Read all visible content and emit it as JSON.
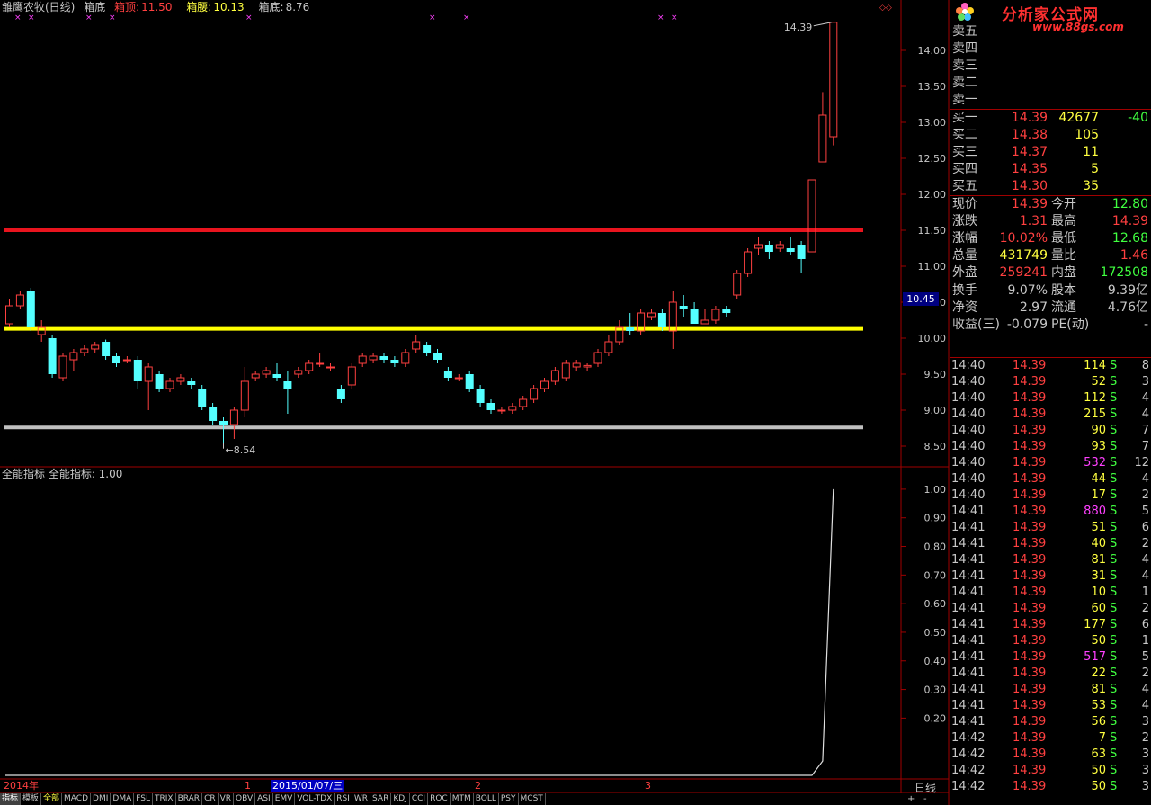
{
  "header": {
    "stock_name": "雏鹰农牧(日线)",
    "box_label": "箱底",
    "top_label": "箱顶:",
    "top_value": "11.50",
    "mid_label": "箱腰:",
    "mid_value": "10.13",
    "bot_label": "箱底:",
    "bot_value": "8.76"
  },
  "colors": {
    "up": "#ff4040",
    "down": "#54ffff",
    "box_top": "#e8141e",
    "box_mid": "#ffff00",
    "box_bot": "#c0c0c0",
    "marker": "#ff40ff",
    "grid": "#a00000"
  },
  "chart_data": [
    {
      "type": "candlestick",
      "ylim": [
        8.3,
        14.5
      ],
      "yticks": [
        "14.00",
        "13.50",
        "13.00",
        "12.50",
        "12.00",
        "11.50",
        "11.00",
        "10.50",
        "10.00",
        "9.50",
        "9.00",
        "8.50"
      ],
      "current_price": "10.45",
      "box_lines": {
        "top": 11.5,
        "mid": 10.13,
        "bot": 8.76
      },
      "high_annotation": "14.39",
      "low_annotation": "8.54",
      "candles": [
        [
          10.2,
          10.45,
          10.55,
          10.15
        ],
        [
          10.45,
          10.6,
          10.65,
          10.4
        ],
        [
          10.65,
          10.15,
          10.7,
          10.1
        ],
        [
          10.05,
          10.15,
          10.25,
          9.95
        ],
        [
          10.0,
          9.5,
          10.05,
          9.45
        ],
        [
          9.45,
          9.75,
          9.8,
          9.4
        ],
        [
          9.7,
          9.8,
          9.85,
          9.55
        ],
        [
          9.8,
          9.85,
          9.9,
          9.75
        ],
        [
          9.85,
          9.9,
          9.95,
          9.8
        ],
        [
          9.95,
          9.75,
          9.98,
          9.7
        ],
        [
          9.75,
          9.65,
          9.8,
          9.6
        ],
        [
          9.7,
          9.7,
          9.75,
          9.65
        ],
        [
          9.7,
          9.4,
          9.75,
          9.3
        ],
        [
          9.4,
          9.6,
          9.65,
          9.0
        ],
        [
          9.5,
          9.3,
          9.55,
          9.25
        ],
        [
          9.3,
          9.4,
          9.45,
          9.25
        ],
        [
          9.4,
          9.45,
          9.5,
          9.35
        ],
        [
          9.4,
          9.35,
          9.45,
          9.3
        ],
        [
          9.3,
          9.05,
          9.35,
          9.0
        ],
        [
          9.05,
          8.85,
          9.1,
          8.8
        ],
        [
          8.85,
          8.8,
          8.9,
          8.54
        ],
        [
          8.8,
          9.0,
          9.05,
          8.6
        ],
        [
          9.0,
          9.4,
          9.6,
          8.9
        ],
        [
          9.45,
          9.5,
          9.55,
          9.4
        ],
        [
          9.5,
          9.55,
          9.6,
          9.45
        ],
        [
          9.5,
          9.45,
          9.65,
          9.4
        ],
        [
          9.4,
          9.3,
          9.55,
          8.95
        ],
        [
          9.5,
          9.55,
          9.6,
          9.45
        ],
        [
          9.55,
          9.65,
          9.7,
          9.5
        ],
        [
          9.65,
          9.65,
          9.8,
          9.6
        ],
        [
          9.6,
          9.6,
          9.65,
          9.55
        ],
        [
          9.3,
          9.15,
          9.35,
          9.1
        ],
        [
          9.35,
          9.6,
          9.65,
          9.3
        ],
        [
          9.65,
          9.75,
          9.8,
          9.6
        ],
        [
          9.7,
          9.75,
          9.8,
          9.65
        ],
        [
          9.75,
          9.7,
          9.8,
          9.65
        ],
        [
          9.7,
          9.65,
          9.75,
          9.6
        ],
        [
          9.65,
          9.8,
          9.85,
          9.6
        ],
        [
          9.85,
          9.95,
          10.05,
          9.8
        ],
        [
          9.9,
          9.8,
          9.95,
          9.75
        ],
        [
          9.8,
          9.7,
          9.85,
          9.65
        ],
        [
          9.55,
          9.45,
          9.6,
          9.4
        ],
        [
          9.45,
          9.45,
          9.5,
          9.4
        ],
        [
          9.5,
          9.3,
          9.55,
          9.25
        ],
        [
          9.3,
          9.1,
          9.35,
          9.05
        ],
        [
          9.1,
          9.0,
          9.15,
          8.95
        ],
        [
          9.0,
          9.0,
          9.05,
          8.95
        ],
        [
          9.0,
          9.05,
          9.1,
          8.95
        ],
        [
          9.05,
          9.15,
          9.2,
          9.0
        ],
        [
          9.15,
          9.3,
          9.35,
          9.1
        ],
        [
          9.3,
          9.4,
          9.45,
          9.25
        ],
        [
          9.4,
          9.55,
          9.6,
          9.35
        ],
        [
          9.45,
          9.65,
          9.7,
          9.4
        ],
        [
          9.6,
          9.65,
          9.7,
          9.55
        ],
        [
          9.6,
          9.62,
          9.65,
          9.55
        ],
        [
          9.65,
          9.8,
          9.85,
          9.6
        ],
        [
          9.8,
          9.95,
          10.05,
          9.75
        ],
        [
          9.95,
          10.15,
          10.25,
          9.9
        ],
        [
          10.15,
          10.1,
          10.35,
          10.05
        ],
        [
          10.1,
          10.35,
          10.4,
          10.05
        ],
        [
          10.3,
          10.35,
          10.4,
          10.25
        ],
        [
          10.35,
          10.15,
          10.4,
          10.1
        ],
        [
          10.1,
          10.5,
          10.65,
          9.85
        ],
        [
          10.45,
          10.4,
          10.6,
          10.3
        ],
        [
          10.4,
          10.2,
          10.5,
          10.2
        ],
        [
          10.2,
          10.25,
          10.4,
          10.2
        ],
        [
          10.25,
          10.4,
          10.45,
          10.2
        ],
        [
          10.4,
          10.35,
          10.45,
          10.3
        ],
        [
          10.6,
          10.9,
          10.95,
          10.55
        ],
        [
          10.9,
          11.2,
          11.25,
          10.85
        ],
        [
          11.25,
          11.3,
          11.4,
          11.15
        ],
        [
          11.3,
          11.2,
          11.35,
          11.1
        ],
        [
          11.25,
          11.3,
          11.35,
          11.2
        ],
        [
          11.25,
          11.2,
          11.4,
          11.15
        ],
        [
          11.3,
          11.1,
          11.35,
          10.9
        ],
        [
          11.2,
          12.2,
          12.2,
          11.2
        ],
        [
          12.45,
          13.1,
          13.42,
          12.45
        ],
        [
          12.8,
          14.39,
          14.39,
          12.68
        ]
      ],
      "marker_x_fractions": [
        0.016,
        0.031,
        0.095,
        0.121,
        0.273,
        0.477,
        0.515,
        0.731,
        0.746
      ]
    },
    {
      "type": "line",
      "title": "全能指标 全能指标: 1.00",
      "ylim": [
        0,
        1.05
      ],
      "yticks": [
        "1.00",
        "0.90",
        "0.80",
        "0.70",
        "0.60",
        "0.50",
        "0.40",
        "0.30",
        "0.20"
      ],
      "note": "value 0 until the last bars, rising to 1.00",
      "values_tail": [
        0,
        0,
        0,
        0.05,
        1.0
      ]
    }
  ],
  "timeline": {
    "labels": [
      "2014年",
      "1",
      "2015/01/07/三",
      "2",
      "3"
    ],
    "right_label": "日线"
  },
  "tabs": [
    "指标",
    "模板",
    "全部",
    "MACD",
    "DMI",
    "DMA",
    "FSL",
    "TRIX",
    "BRAR",
    "CR",
    "VR",
    "OBV",
    "ASI",
    "EMV",
    "VOL-TDX",
    "RSI",
    "WR",
    "SAR",
    "KDJ",
    "CCI",
    "ROC",
    "MTM",
    "BOLL",
    "PSY",
    "MCST"
  ],
  "logo": {
    "text": "分析家公式网",
    "url": "www.88gs.com"
  },
  "order_book": {
    "sell": [
      {
        "label": "卖五",
        "price": "",
        "vol": ""
      },
      {
        "label": "卖四",
        "price": "",
        "vol": ""
      },
      {
        "label": "卖三",
        "price": "",
        "vol": ""
      },
      {
        "label": "卖二",
        "price": "",
        "vol": ""
      },
      {
        "label": "卖一",
        "price": "",
        "vol": ""
      }
    ],
    "buy": [
      {
        "label": "买一",
        "price": "14.39",
        "vol": "42677",
        "chg": "-40"
      },
      {
        "label": "买二",
        "price": "14.38",
        "vol": "105",
        "chg": ""
      },
      {
        "label": "买三",
        "price": "14.37",
        "vol": "11",
        "chg": ""
      },
      {
        "label": "买四",
        "price": "14.35",
        "vol": "5",
        "chg": ""
      },
      {
        "label": "买五",
        "price": "14.30",
        "vol": "35",
        "chg": ""
      }
    ]
  },
  "quote": [
    {
      "l1": "现价",
      "v1": "14.39",
      "c1": "red",
      "l2": "今开",
      "v2": "12.80",
      "c2": "grn"
    },
    {
      "l1": "涨跌",
      "v1": "1.31",
      "c1": "red",
      "l2": "最高",
      "v2": "14.39",
      "c2": "red"
    },
    {
      "l1": "涨幅",
      "v1": "10.02%",
      "c1": "red",
      "l2": "最低",
      "v2": "12.68",
      "c2": "grn"
    },
    {
      "l1": "总量",
      "v1": "431749",
      "c1": "yel",
      "l2": "量比",
      "v2": "1.46",
      "c2": "red"
    },
    {
      "l1": "外盘",
      "v1": "259241",
      "c1": "red",
      "l2": "内盘",
      "v2": "172508",
      "c2": "grn"
    }
  ],
  "finance": [
    {
      "l1": "换手",
      "v1": "9.07%",
      "l2": "股本",
      "v2": "9.39亿"
    },
    {
      "l1": "净资",
      "v1": "2.97",
      "l2": "流通",
      "v2": "4.76亿"
    },
    {
      "l1": "收益(三)",
      "v1": "-0.079",
      "l2": "PE(动)",
      "v2": "-"
    }
  ],
  "ticks": [
    {
      "time": "14:40",
      "price": "14.39",
      "vol": "114",
      "vc": "yel",
      "bs": "S",
      "n": "8"
    },
    {
      "time": "14:40",
      "price": "14.39",
      "vol": "52",
      "vc": "yel",
      "bs": "S",
      "n": "3"
    },
    {
      "time": "14:40",
      "price": "14.39",
      "vol": "112",
      "vc": "yel",
      "bs": "S",
      "n": "4"
    },
    {
      "time": "14:40",
      "price": "14.39",
      "vol": "215",
      "vc": "yel",
      "bs": "S",
      "n": "4"
    },
    {
      "time": "14:40",
      "price": "14.39",
      "vol": "90",
      "vc": "yel",
      "bs": "S",
      "n": "7"
    },
    {
      "time": "14:40",
      "price": "14.39",
      "vol": "93",
      "vc": "yel",
      "bs": "S",
      "n": "7"
    },
    {
      "time": "14:40",
      "price": "14.39",
      "vol": "532",
      "vc": "mag",
      "bs": "S",
      "n": "12"
    },
    {
      "time": "14:40",
      "price": "14.39",
      "vol": "44",
      "vc": "yel",
      "bs": "S",
      "n": "4"
    },
    {
      "time": "14:40",
      "price": "14.39",
      "vol": "17",
      "vc": "yel",
      "bs": "S",
      "n": "2"
    },
    {
      "time": "14:41",
      "price": "14.39",
      "vol": "880",
      "vc": "mag",
      "bs": "S",
      "n": "5"
    },
    {
      "time": "14:41",
      "price": "14.39",
      "vol": "51",
      "vc": "yel",
      "bs": "S",
      "n": "6"
    },
    {
      "time": "14:41",
      "price": "14.39",
      "vol": "40",
      "vc": "yel",
      "bs": "S",
      "n": "2"
    },
    {
      "time": "14:41",
      "price": "14.39",
      "vol": "81",
      "vc": "yel",
      "bs": "S",
      "n": "4"
    },
    {
      "time": "14:41",
      "price": "14.39",
      "vol": "31",
      "vc": "yel",
      "bs": "S",
      "n": "4"
    },
    {
      "time": "14:41",
      "price": "14.39",
      "vol": "10",
      "vc": "yel",
      "bs": "S",
      "n": "1"
    },
    {
      "time": "14:41",
      "price": "14.39",
      "vol": "60",
      "vc": "yel",
      "bs": "S",
      "n": "2"
    },
    {
      "time": "14:41",
      "price": "14.39",
      "vol": "177",
      "vc": "yel",
      "bs": "S",
      "n": "6"
    },
    {
      "time": "14:41",
      "price": "14.39",
      "vol": "50",
      "vc": "yel",
      "bs": "S",
      "n": "1"
    },
    {
      "time": "14:41",
      "price": "14.39",
      "vol": "517",
      "vc": "mag",
      "bs": "S",
      "n": "5"
    },
    {
      "time": "14:41",
      "price": "14.39",
      "vol": "22",
      "vc": "yel",
      "bs": "S",
      "n": "2"
    },
    {
      "time": "14:41",
      "price": "14.39",
      "vol": "81",
      "vc": "yel",
      "bs": "S",
      "n": "4"
    },
    {
      "time": "14:41",
      "price": "14.39",
      "vol": "53",
      "vc": "yel",
      "bs": "S",
      "n": "4"
    },
    {
      "time": "14:41",
      "price": "14.39",
      "vol": "56",
      "vc": "yel",
      "bs": "S",
      "n": "3"
    },
    {
      "time": "14:42",
      "price": "14.39",
      "vol": "7",
      "vc": "yel",
      "bs": "S",
      "n": "2"
    },
    {
      "time": "14:42",
      "price": "14.39",
      "vol": "63",
      "vc": "yel",
      "bs": "S",
      "n": "3"
    },
    {
      "time": "14:42",
      "price": "14.39",
      "vol": "50",
      "vc": "yel",
      "bs": "S",
      "n": "3"
    },
    {
      "time": "14:42",
      "price": "14.39",
      "vol": "50",
      "vc": "yel",
      "bs": "S",
      "n": "3"
    }
  ]
}
